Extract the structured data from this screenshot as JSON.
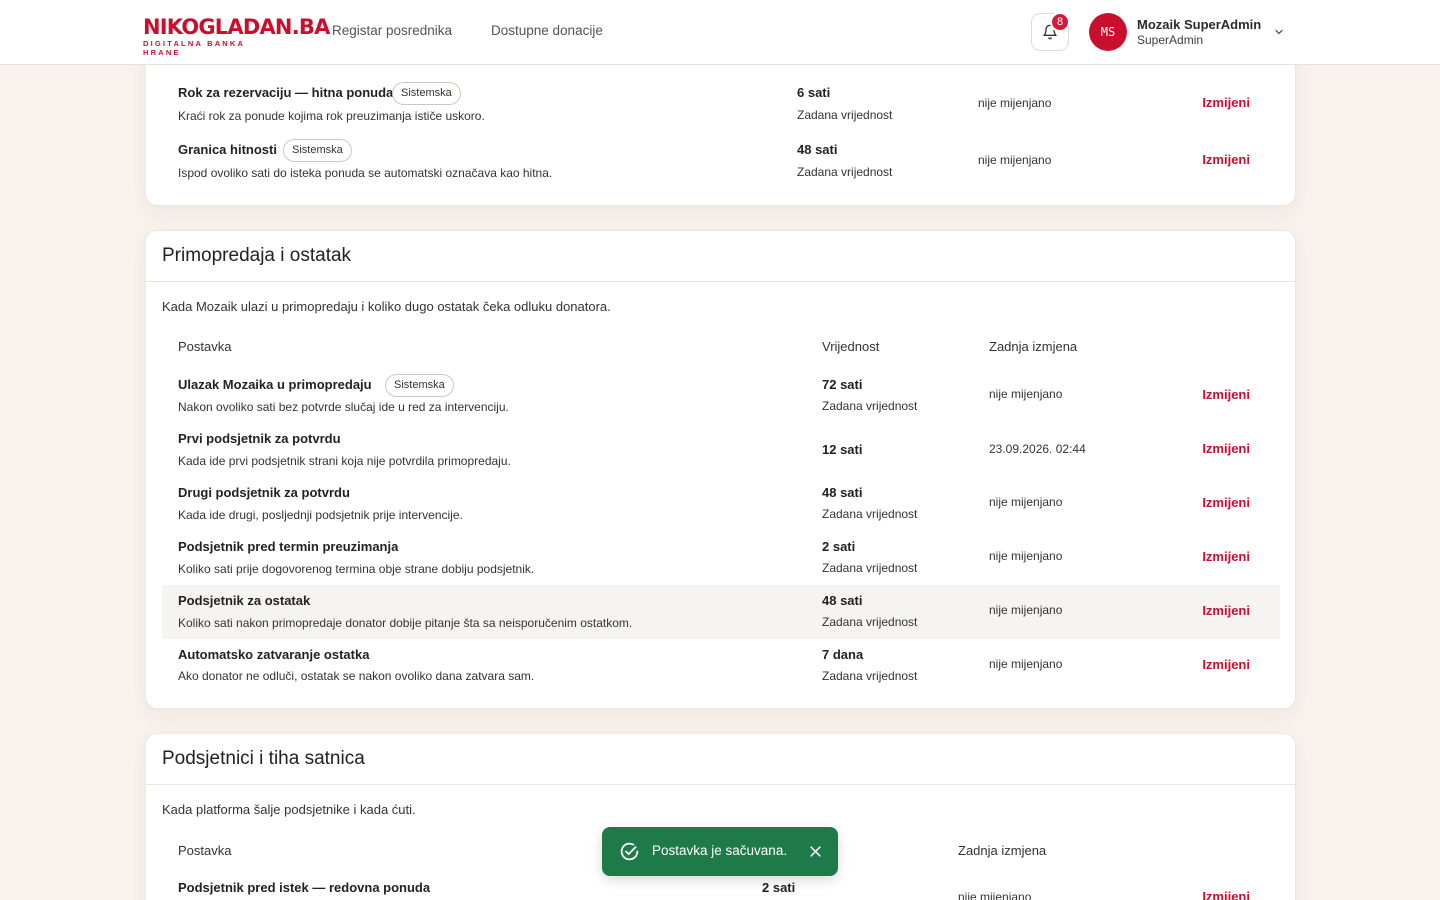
{
  "header": {
    "logo_main_a": "NIKO",
    "logo_main_b": "GLADAN",
    "logo_main_c": ".BA",
    "logo_sub": "DIGITALNA BANKA HRANE",
    "nav": [
      "Registar posrednika",
      "Dostupne donacije"
    ],
    "notifications_count": "8",
    "user": {
      "initials": "MS",
      "name": "Mozaik SuperAdmin",
      "role": "SuperAdmin"
    }
  },
  "section1": {
    "rows": [
      {
        "title": "Rok za rezervaciju — hitna ponuda",
        "tag": "Sistemska",
        "desc": "Kraći rok za ponude kojima rok preuzimanja ističe uskoro.",
        "value": "6 sati",
        "default": "Zadana vrijednost",
        "changed": "nije mijenjano",
        "action": "Izmijeni"
      },
      {
        "title": "Granica hitnosti",
        "tag": "Sistemska",
        "desc": "Ispod ovoliko sati do isteka ponuda se automatski označava kao hitna.",
        "value": "48 sati",
        "default": "Zadana vrijednost",
        "changed": "nije mijenjano",
        "action": "Izmijeni"
      }
    ]
  },
  "section2": {
    "title": "Primopredaja i ostatak",
    "desc": "Kada Mozaik ulazi u primopredaju i koliko dugo ostatak čeka odluku donatora.",
    "columns": {
      "setting": "Postavka",
      "value": "Vrijednost",
      "changed": "Zadnja izmjena"
    },
    "rows": [
      {
        "title": "Ulazak Mozaika u primopredaju",
        "tag": "Sistemska",
        "desc": "Nakon ovoliko sati bez potvrde slučaj ide u red za intervenciju.",
        "value": "72 sati",
        "default": "Zadana vrijednost",
        "changed": "nije mijenjano",
        "action": "Izmijeni"
      },
      {
        "title": "Prvi podsjetnik za potvrdu",
        "desc": "Kada ide prvi podsjetnik strani koja nije potvrdila primopredaju.",
        "value": "12 sati",
        "default": "",
        "changed": "23.09.2026. 02:44",
        "action": "Izmijeni"
      },
      {
        "title": "Drugi podsjetnik za potvrdu",
        "desc": "Kada ide drugi, posljednji podsjetnik prije intervencije.",
        "value": "48 sati",
        "default": "Zadana vrijednost",
        "changed": "nije mijenjano",
        "action": "Izmijeni"
      },
      {
        "title": "Podsjetnik pred termin preuzimanja",
        "desc": "Koliko sati prije dogovorenog termina obje strane dobiju podsjetnik.",
        "value": "2 sati",
        "default": "Zadana vrijednost",
        "changed": "nije mijenjano",
        "action": "Izmijeni"
      },
      {
        "title": "Podsjetnik za ostatak",
        "desc": "Koliko sati nakon primopredaje donator dobije pitanje šta sa neisporučenim ostatkom.",
        "value": "48 sati",
        "default": "Zadana vrijednost",
        "changed": "nije mijenjano",
        "action": "Izmijeni"
      },
      {
        "title": "Automatsko zatvaranje ostatka",
        "desc": "Ako donator ne odluči, ostatak se nakon ovoliko dana zatvara sam.",
        "value": "7 dana",
        "default": "Zadana vrijednost",
        "changed": "nije mijenjano",
        "action": "Izmijeni"
      }
    ]
  },
  "section3": {
    "title": "Podsjetnici i tiha satnica",
    "desc": "Kada platforma šalje podsjetnike i kada ćuti.",
    "columns": {
      "setting": "Postavka",
      "changed": "Zadnja izmjena"
    },
    "rows": [
      {
        "title": "Podsjetnik pred istek — redovna ponuda",
        "value": "2 sati",
        "changed": "nije mijenjano",
        "action": "Izmijeni"
      }
    ]
  },
  "toast": {
    "text": "Postavka je sačuvana."
  }
}
